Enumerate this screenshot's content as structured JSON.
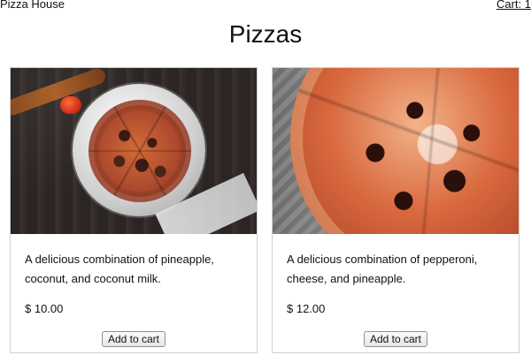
{
  "header": {
    "brand": "Pizza House",
    "cart": "Cart: 1"
  },
  "main": {
    "title": "Pizzas",
    "cards": [
      {
        "description": "A delicious combination of pineapple, coconut, and coconut milk.",
        "price": "$ 10.00",
        "button_label": "Add to cart"
      },
      {
        "description": "A delicious combination of pepperoni, cheese, and pineapple.",
        "price": "$ 12.00",
        "button_label": "Add to cart"
      }
    ]
  }
}
